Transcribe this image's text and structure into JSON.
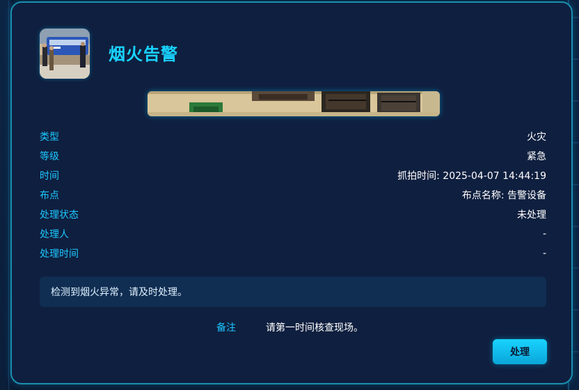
{
  "dialog": {
    "title": "烟火告警",
    "fields": [
      {
        "label": "类型",
        "value": "火灾"
      },
      {
        "label": "等级",
        "value": "紧急"
      },
      {
        "label": "时间",
        "value": "抓拍时间: 2025-04-07 14:44:19"
      },
      {
        "label": "布点",
        "value": "布点名称: 告警设备"
      },
      {
        "label": "处理状态",
        "value": "未处理"
      },
      {
        "label": "处理人",
        "value": "-"
      },
      {
        "label": "处理时间",
        "value": "-"
      }
    ],
    "notice": "检测到烟火异常，请及时处理。",
    "remark": {
      "label": "备注",
      "value": "请第一时间核查现场。"
    },
    "action_button": "处理"
  },
  "colors": {
    "accent": "#19d3ff",
    "label": "#1cc8ff",
    "panel": "#0f1f3f",
    "border": "#1a8fb0",
    "notice_bg": "#102d52"
  }
}
